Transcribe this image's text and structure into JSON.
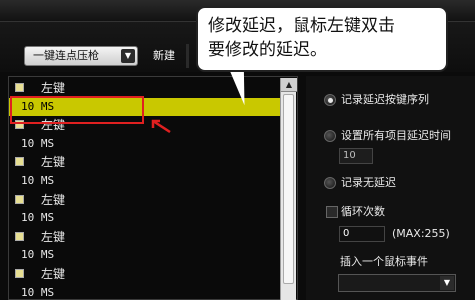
{
  "toolbar": {
    "macro_name": "一键连点压枪",
    "new_label": "新建"
  },
  "callout": {
    "line1": "修改延迟，鼠标左键双击",
    "line2": "要修改的延迟。"
  },
  "list": {
    "rows": [
      {
        "type": "key",
        "text": "左键",
        "selected": false
      },
      {
        "type": "delay",
        "text": "10 MS",
        "selected": true
      },
      {
        "type": "key",
        "text": "左键",
        "selected": false
      },
      {
        "type": "delay",
        "text": "10 MS",
        "selected": false
      },
      {
        "type": "key",
        "text": "左键",
        "selected": false
      },
      {
        "type": "delay",
        "text": "10 MS",
        "selected": false
      },
      {
        "type": "key",
        "text": "左键",
        "selected": false
      },
      {
        "type": "delay",
        "text": "10 MS",
        "selected": false
      },
      {
        "type": "key",
        "text": "左键",
        "selected": false
      },
      {
        "type": "delay",
        "text": "10 MS",
        "selected": false
      },
      {
        "type": "key",
        "text": "左键",
        "selected": false
      },
      {
        "type": "delay",
        "text": "10 MS",
        "selected": false
      }
    ]
  },
  "options": {
    "record_delay_label": "记录延迟按键序列",
    "set_all_delay_label": "设置所有项目延迟时间",
    "all_delay_value": "10",
    "no_delay_label": "记录无延迟",
    "loop_label": "循环次数",
    "loop_value": "0",
    "loop_max": "(MAX:255)",
    "insert_mouse_label": "插入一个鼠标事件"
  },
  "colors": {
    "selection": "#c9c800",
    "highlight_border": "#e02020"
  }
}
